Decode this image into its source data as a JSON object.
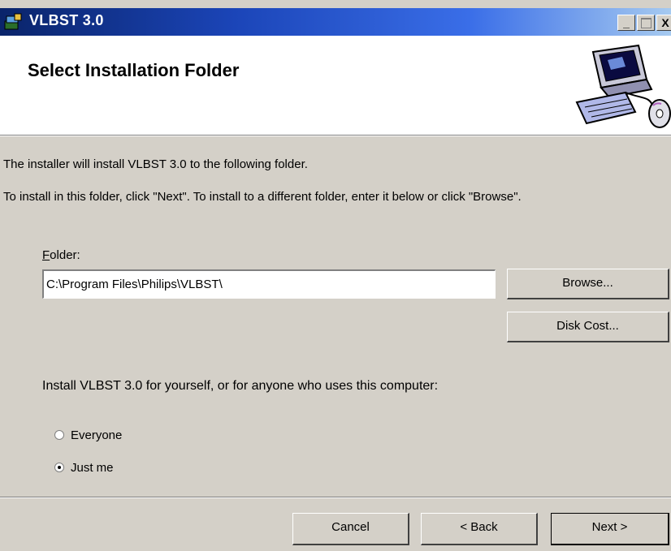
{
  "window": {
    "title": "VLBST 3.0",
    "minimize_glyph": "_",
    "close_glyph": "X"
  },
  "banner": {
    "title": "Select Installation Folder"
  },
  "intro": {
    "line1": "The installer will install VLBST 3.0 to the following folder.",
    "line2": "To install in this folder, click \"Next\". To install to a different folder, enter it below or click \"Browse\"."
  },
  "folder": {
    "label_accel": "F",
    "label_rest": "older:",
    "value": "C:\\Program Files\\Philips\\VLBST\\"
  },
  "buttons": {
    "browse": "Browse...",
    "disk_cost": "Disk Cost...",
    "cancel": "Cancel",
    "back": "< Back",
    "next": "Next >"
  },
  "install_for": {
    "prompt": "Install VLBST 3.0 for yourself, or for anyone who uses this computer:",
    "options": [
      {
        "label": "Everyone",
        "selected": false
      },
      {
        "label": "Just me",
        "selected": true
      }
    ]
  }
}
